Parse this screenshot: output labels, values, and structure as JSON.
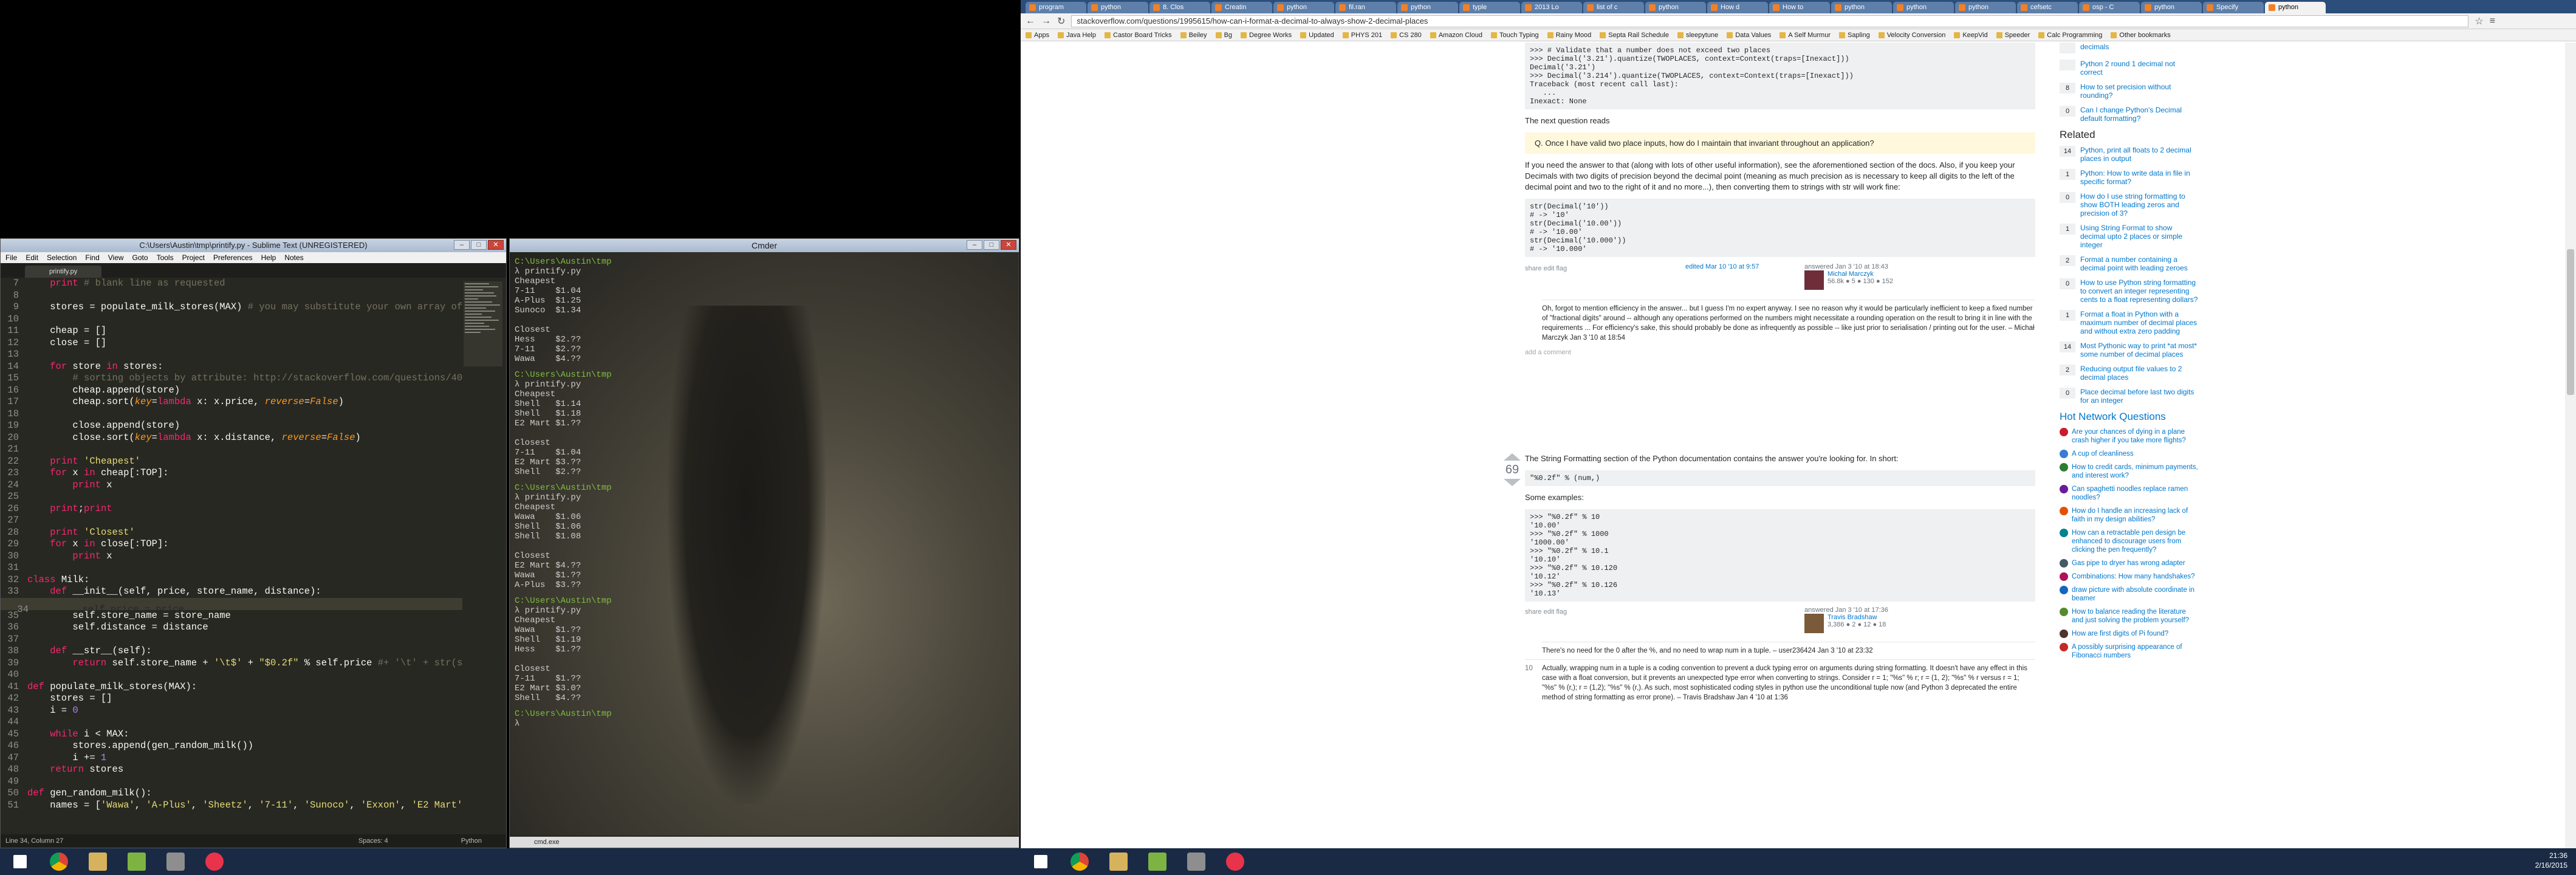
{
  "sublime": {
    "title": "C:\\Users\\Austin\\tmp\\printify.py - Sublime Text (UNREGISTERED)",
    "menu": [
      "File",
      "Edit",
      "Selection",
      "Find",
      "View",
      "Goto",
      "Tools",
      "Project",
      "Preferences",
      "Help",
      "Notes"
    ],
    "tab": "printify.py",
    "status": "Line 34, Column 27",
    "status_right": [
      "Spaces: 4",
      "Python"
    ],
    "lines": [
      {
        "n": "7",
        "t": "    print # blank line as requested"
      },
      {
        "n": "8",
        "t": ""
      },
      {
        "n": "9",
        "t": "    stores = populate_milk_stores(MAX) # you may substitute your own array of"
      },
      {
        "n": "10",
        "t": ""
      },
      {
        "n": "11",
        "t": "    cheap = []"
      },
      {
        "n": "12",
        "t": "    close = []"
      },
      {
        "n": "13",
        "t": ""
      },
      {
        "n": "14",
        "t": "    for store in stores:"
      },
      {
        "n": "15",
        "t": "        # sorting objects by attribute: http://stackoverflow.com/questions/40"
      },
      {
        "n": "16",
        "t": "        cheap.append(store)"
      },
      {
        "n": "17",
        "t": "        cheap.sort(key=lambda x: x.price, reverse=False)"
      },
      {
        "n": "18",
        "t": ""
      },
      {
        "n": "19",
        "t": "        close.append(store)"
      },
      {
        "n": "20",
        "t": "        close.sort(key=lambda x: x.distance, reverse=False)"
      },
      {
        "n": "21",
        "t": ""
      },
      {
        "n": "22",
        "t": "    print 'Cheapest'"
      },
      {
        "n": "23",
        "t": "    for x in cheap[:TOP]:"
      },
      {
        "n": "24",
        "t": "        print x"
      },
      {
        "n": "25",
        "t": ""
      },
      {
        "n": "26",
        "t": "    print;print"
      },
      {
        "n": "27",
        "t": ""
      },
      {
        "n": "28",
        "t": "    print 'Closest'"
      },
      {
        "n": "29",
        "t": "    for x in close[:TOP]:"
      },
      {
        "n": "30",
        "t": "        print x"
      },
      {
        "n": "31",
        "t": ""
      },
      {
        "n": "32",
        "t": "class Milk:"
      },
      {
        "n": "33",
        "t": "    def __init__(self, price, store_name, distance):"
      },
      {
        "n": "34",
        "t": "        self.price = price"
      },
      {
        "n": "35",
        "t": "        self.store_name = store_name"
      },
      {
        "n": "36",
        "t": "        self.distance = distance"
      },
      {
        "n": "37",
        "t": ""
      },
      {
        "n": "38",
        "t": "    def __str__(self):"
      },
      {
        "n": "39",
        "t": "        return self.store_name + '\\t$' + \"$0.2f\" % self.price #+ '\\t' + str(se"
      },
      {
        "n": "40",
        "t": ""
      },
      {
        "n": "41",
        "t": "def populate_milk_stores(MAX):"
      },
      {
        "n": "42",
        "t": "    stores = []"
      },
      {
        "n": "43",
        "t": "    i = 0"
      },
      {
        "n": "44",
        "t": ""
      },
      {
        "n": "45",
        "t": "    while i < MAX:"
      },
      {
        "n": "46",
        "t": "        stores.append(gen_random_milk())"
      },
      {
        "n": "47",
        "t": "        i += 1"
      },
      {
        "n": "48",
        "t": "    return stores"
      },
      {
        "n": "49",
        "t": ""
      },
      {
        "n": "50",
        "t": "def gen_random_milk():"
      },
      {
        "n": "51",
        "t": "    names = ['Wawa', 'A-Plus', 'Sheetz', '7-11', 'Sunoco', 'Exxon', 'E2 Mart'"
      }
    ]
  },
  "cmder": {
    "title": "Cmder",
    "status": "cmd.exe",
    "blocks": [
      {
        "path": "C:\\Users\\Austin\\tmp",
        "cmd": "λ printify.py",
        "out": [
          "Cheapest",
          "7-11    $1.04",
          "A-Plus  $1.25",
          "Sunoco  $1.34",
          "",
          "Closest",
          "Hess    $2.??",
          "7-11    $2.??",
          "Wawa    $4.??"
        ]
      },
      {
        "path": "C:\\Users\\Austin\\tmp",
        "cmd": "λ printify.py",
        "out": [
          "Cheapest",
          "Shell   $1.14",
          "Shell   $1.18",
          "E2 Mart $1.??",
          "",
          "Closest",
          "7-11    $1.04",
          "E2 Mart $3.??",
          "Shell   $2.??"
        ]
      },
      {
        "path": "C:\\Users\\Austin\\tmp",
        "cmd": "λ printify.py",
        "out": [
          "Cheapest",
          "Wawa    $1.06",
          "Shell   $1.06",
          "Shell   $1.08",
          "",
          "Closest",
          "E2 Mart $4.??",
          "Wawa    $1.??",
          "A-Plus  $3.??"
        ]
      },
      {
        "path": "C:\\Users\\Austin\\tmp",
        "cmd": "λ printify.py",
        "out": [
          "Cheapest",
          "Wawa    $1.??",
          "Shell   $1.19",
          "Hess    $1.??",
          "",
          "Closest",
          "7-11    $1.??",
          "E2 Mart $3.0?",
          "Shell   $4.??"
        ]
      },
      {
        "path": "C:\\Users\\Austin\\tmp",
        "cmd": "λ",
        "out": []
      }
    ]
  },
  "chrome": {
    "tabs": [
      "program",
      "python",
      "8. Clos",
      "Creatin",
      "python",
      "fil.ran",
      "python",
      "typle",
      "2013 Lo",
      "list of c",
      "python",
      "How d",
      "How to",
      "python",
      "python",
      "python",
      "cefsetc",
      "osp - C",
      "python",
      "Specify",
      "python"
    ],
    "url": "stackoverflow.com/questions/1995615/how-can-i-format-a-decimal-to-always-show-2-decimal-places",
    "bookmarks": [
      "Apps",
      "Java Help",
      "Castor Board Tricks",
      "Beiley",
      "Bg",
      "Degree Works",
      "Updated",
      "PHYS 201",
      "CS 280",
      "Amazon Cloud",
      "Touch Typing",
      "Rainy Mood",
      "Septa Rail Schedule",
      "sleepytune",
      "Data Values",
      "A Self Murmur",
      "Sapling",
      "Velocity Conversion",
      "KeepVid",
      "Speeder",
      "Calc Programming",
      "Other bookmarks"
    ],
    "code1": [
      ">>> # Validate that a number does not exceed two places",
      ">>> Decimal('3.21').quantize(TWOPLACES, context=Context(traps=[Inexact]))",
      "Decimal('3.21')",
      ">>> Decimal('3.214').quantize(TWOPLACES, context=Context(traps=[Inexact]))",
      "Traceback (most recent call last):",
      "   ...",
      "Inexact: None"
    ],
    "next_q": "The next question reads",
    "q_box": "Q. Once I have valid two place inputs, how do I maintain that invariant throughout an application?",
    "p1": "If you need the answer to that (along with lots of other useful information), see the aforementioned section of the docs. Also, if you keep your Decimals with two digits of precision beyond the decimal point (meaning as much precision as is necessary to keep all digits to the left of the decimal point and two to the right of it and no more...), then converting them to strings with str will work fine:",
    "code2": [
      "str(Decimal('10'))",
      "# -> '10'",
      "str(Decimal('10.00'))",
      "# -> '10.00'",
      "str(Decimal('10.000'))",
      "# -> '10.000'"
    ],
    "meta1": "share edit flag",
    "edited": "edited Mar 10 '10 at 9:57",
    "answered1": "answered Jan 3 '10 at 18:43",
    "user1": "Michał Marczyk",
    "rep1": "56.8k  ● 5  ● 130  ● 152",
    "comment1": "Oh, forgot to mention efficiency in the answer... but I guess I'm no expert anyway. I see no reason why it would be particularly inefficient to keep a fixed number of \"fractional digits\" around -- although any operations performed on the numbers might necessitate a rounding operation on the result to bring it in line with the requirements ... For efficiency's sake, this should probably be done as infrequently as possible -- like just prior to serialisation / printing out for the user. – Michał Marczyk Jan 3 '10 at 18:54",
    "add_comment": "add a comment",
    "votes2": "69",
    "p2": "The String Formatting section of the Python documentation contains the answer you're looking for. In short:",
    "code3": "\"%0.2f\" % (num,)",
    "examples": "Some examples:",
    "code4": [
      ">>> \"%0.2f\" % 10",
      "'10.00'",
      ">>> \"%0.2f\" % 1000",
      "'1000.00'",
      ">>> \"%0.2f\" % 10.1",
      "'10.10'",
      ">>> \"%0.2f\" % 10.120",
      "'10.12'",
      ">>> \"%0.2f\" % 10.126",
      "'10.13'"
    ],
    "meta2": "share edit flag",
    "answered2": "answered Jan 3 '10 at 17:36",
    "user2": "Travis Bradshaw",
    "rep2": "3,386  ● 2  ● 12  ● 18",
    "comment2a": "There's no need for the 0 after the %, and no need to wrap num in a tuple. – user236424 Jan 3 '10 at 23:32",
    "comment2b_score": "10",
    "comment2b": "Actually, wrapping num in a tuple is a coding convention to prevent a duck typing error on arguments during string formatting. It doesn't have any effect in this case with a float conversion, but it prevents an unexpected type error when converting to strings. Consider r = 1; \"%s\" % r; r = (1, 2); \"%s\" % r versus r = 1; \"%s\" % (r,); r = (1,2); \"%s\" % (r,). As such, most sophisticated coding styles in python use the unconditional tuple now (and Python 3 deprecated the entire method of string formatting as error prone). – Travis Bradshaw Jan 4 '10 at 1:36",
    "side_top": [
      {
        "score": "",
        "t": "decimals"
      },
      {
        "score": "",
        "t": "Python 2 round 1 decimal not correct"
      },
      {
        "score": "8",
        "t": "How to set precision without rounding?"
      },
      {
        "score": "0",
        "t": "Can I change Python's Decimal default formatting?"
      }
    ],
    "related_title": "Related",
    "related": [
      {
        "score": "14",
        "t": "Python, print all floats to 2 decimal places in output"
      },
      {
        "score": "1",
        "t": "Python: How to write data in file in specific format?"
      },
      {
        "score": "0",
        "t": "How do I use string formatting to show BOTH leading zeros and precision of 3?"
      },
      {
        "score": "1",
        "t": "Using String Format to show decimal upto 2 places or simple integer"
      },
      {
        "score": "2",
        "t": "Format a number containing a decimal point with leading zeroes"
      },
      {
        "score": "0",
        "t": "How to use Python string formatting to convert an integer representing cents to a float representing dollars?"
      },
      {
        "score": "1",
        "t": "Format a float in Python with a maximum number of decimal places and without extra zero padding"
      },
      {
        "score": "14",
        "t": "Most Pythonic way to print *at most* some number of decimal places"
      },
      {
        "score": "2",
        "t": "Reducing output file values to 2 decimal places"
      },
      {
        "score": "0",
        "t": "Place decimal before last two digits for an integer"
      }
    ],
    "hot_title": "Hot Network Questions",
    "hot": [
      "Are your chances of dying in a plane crash higher if you take more flights?",
      "A cup of cleanliness",
      "How to credit cards, minimum payments, and interest work?",
      "Can spaghetti noodles replace ramen noodles?",
      "How do I handle an increasing lack of faith in my design abilities?",
      "How can a retractable pen design be enhanced to discourage users from clicking the pen frequently?",
      "Gas pipe to dryer has wrong adapter",
      "Combinations: How many handshakes?",
      "draw picture with absolute coordinate in beamer",
      "How to balance reading the literature and just solving the problem yourself?",
      "How are first digits of Pi found?",
      "A possibly surprising appearance of Fibonacci numbers"
    ]
  },
  "taskbar": {
    "clock_time": "21:36",
    "clock_date": "2/16/2015"
  }
}
